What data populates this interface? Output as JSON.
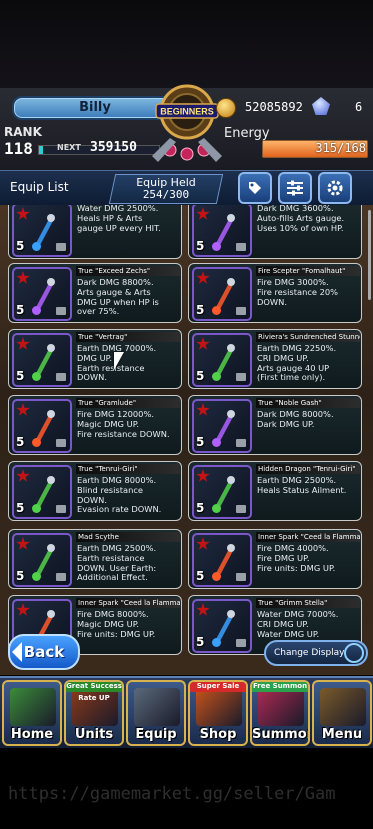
{
  "header": {
    "player_name": "Billy",
    "emblem_label": "BEGINNERS",
    "rank_label": "RANK",
    "rank_value": "118",
    "rank_progress": 0.03,
    "next_label": "NEXT",
    "next_value": "359150",
    "coins": "52085892",
    "gems": "6",
    "energy_label": "Energy",
    "energy_value": "315/168",
    "energy_fill": 1.0
  },
  "equip_bar": {
    "title": "Equip List",
    "held_label": "Equip Held",
    "held_value": "254/300",
    "tag_icon": "tag-icon",
    "sort_icon": "filter-sliders-icon",
    "settings_icon": "gear-icon"
  },
  "items": [
    {
      "name": "",
      "desc": "Water DMG 2500%.\nHeals HP & Arts\ngauge UP every HIT.",
      "rarity": "5",
      "element": "#3aa0ff",
      "frame": "#7a58c9"
    },
    {
      "name": "",
      "desc": "Dark DMG 3600%.\nAuto-fills Arts gauge.\nUses 10% of own HP.",
      "rarity": "5",
      "element": "#b060ff",
      "frame": "#7a58c9"
    },
    {
      "name": "True \"Exceed Zechs\"",
      "desc": "Dark DMG 8800%.\nArts gauge & Arts\nDMG UP when HP is\nover 75%.",
      "rarity": "5",
      "element": "#b060ff",
      "frame": "#7a58c9"
    },
    {
      "name": "Fire Scepter \"Fomalhaut\"",
      "desc": "Fire DMG 3000%.\nFire resistance 20%\nDOWN.",
      "rarity": "5",
      "element": "#ff5a2a",
      "frame": "#7a58c9"
    },
    {
      "name": "True \"Vertrag\"",
      "desc": "Earth DMG 7000%.\nDMG UP.\nEarth resistance\nDOWN.",
      "rarity": "5",
      "element": "#52d14a",
      "frame": "#7a58c9"
    },
    {
      "name": "Riviera's Sundrenched Stunner",
      "desc": "Earth DMG 2250%.\nCRI DMG UP.\nArts gauge 40 UP\n(First time only).",
      "rarity": "5",
      "element": "#52d14a",
      "frame": "#7a58c9"
    },
    {
      "name": "True \"Gramlude\"",
      "desc": "Fire DMG 12000%.\nMagic DMG UP.\nFire resistance DOWN.",
      "rarity": "5",
      "element": "#ff5a2a",
      "frame": "#7a58c9"
    },
    {
      "name": "True \"Noble Gash\"",
      "desc": "Dark DMG 8000%.\nDark DMG UP.",
      "rarity": "5",
      "element": "#b060ff",
      "frame": "#7a58c9"
    },
    {
      "name": "True \"Tenrui-Giri\"",
      "desc": "Earth DMG 8000%.\nBlind resistance\nDOWN.\nEvasion rate DOWN.",
      "rarity": "5",
      "element": "#52d14a",
      "frame": "#7a58c9"
    },
    {
      "name": "Hidden Dragon \"Tenrui-Giri\"",
      "desc": "Earth DMG 2500%.\nHeals Status Ailment.",
      "rarity": "5",
      "element": "#52d14a",
      "frame": "#7a58c9"
    },
    {
      "name": "Mad Scythe",
      "desc": "Earth DMG 2500%.\nEarth resistance\nDOWN. User Earth:\nAdditional Effect.",
      "rarity": "5",
      "element": "#52d14a",
      "frame": "#7a58c9"
    },
    {
      "name": "Inner Spark \"Ceed la Flamma\"",
      "desc": "Fire DMG 4000%.\nFire DMG UP.\nFire units: DMG UP.",
      "rarity": "5",
      "element": "#ff5a2a",
      "frame": "#7a58c9"
    },
    {
      "name": "Inner Spark \"Ceed la Flamma\"",
      "desc": "Fire DMG 8000%.\nMagic DMG UP.\nFire units: DMG UP.",
      "rarity": "5",
      "element": "#ff5a2a",
      "frame": "#7a58c9"
    },
    {
      "name": "True \"Grimm Stella\"",
      "desc": "Water DMG 7000%.\nCRI DMG UP.\nWater DMG UP.",
      "rarity": "5",
      "element": "#3aa0ff",
      "frame": "#7a58c9"
    }
  ],
  "buttons": {
    "back": "Back",
    "change_display": "Change Display"
  },
  "nav": [
    {
      "label": "Home",
      "ribbon": "",
      "color": "#3a8c3a"
    },
    {
      "label": "Units",
      "ribbon": "Great Success Rate UP",
      "color": "#8a3a1a"
    },
    {
      "label": "Equip",
      "ribbon": "",
      "color": "#5a6a7a"
    },
    {
      "label": "Shop",
      "ribbon": "Super Sale",
      "color": "#c8541a"
    },
    {
      "label": "Summon",
      "ribbon": "Free Summon",
      "color": "#b02a52"
    },
    {
      "label": "Menu",
      "ribbon": "",
      "color": "#7a5a2a"
    }
  ],
  "watermark": "https://gamemarket.gg/seller/Gam"
}
